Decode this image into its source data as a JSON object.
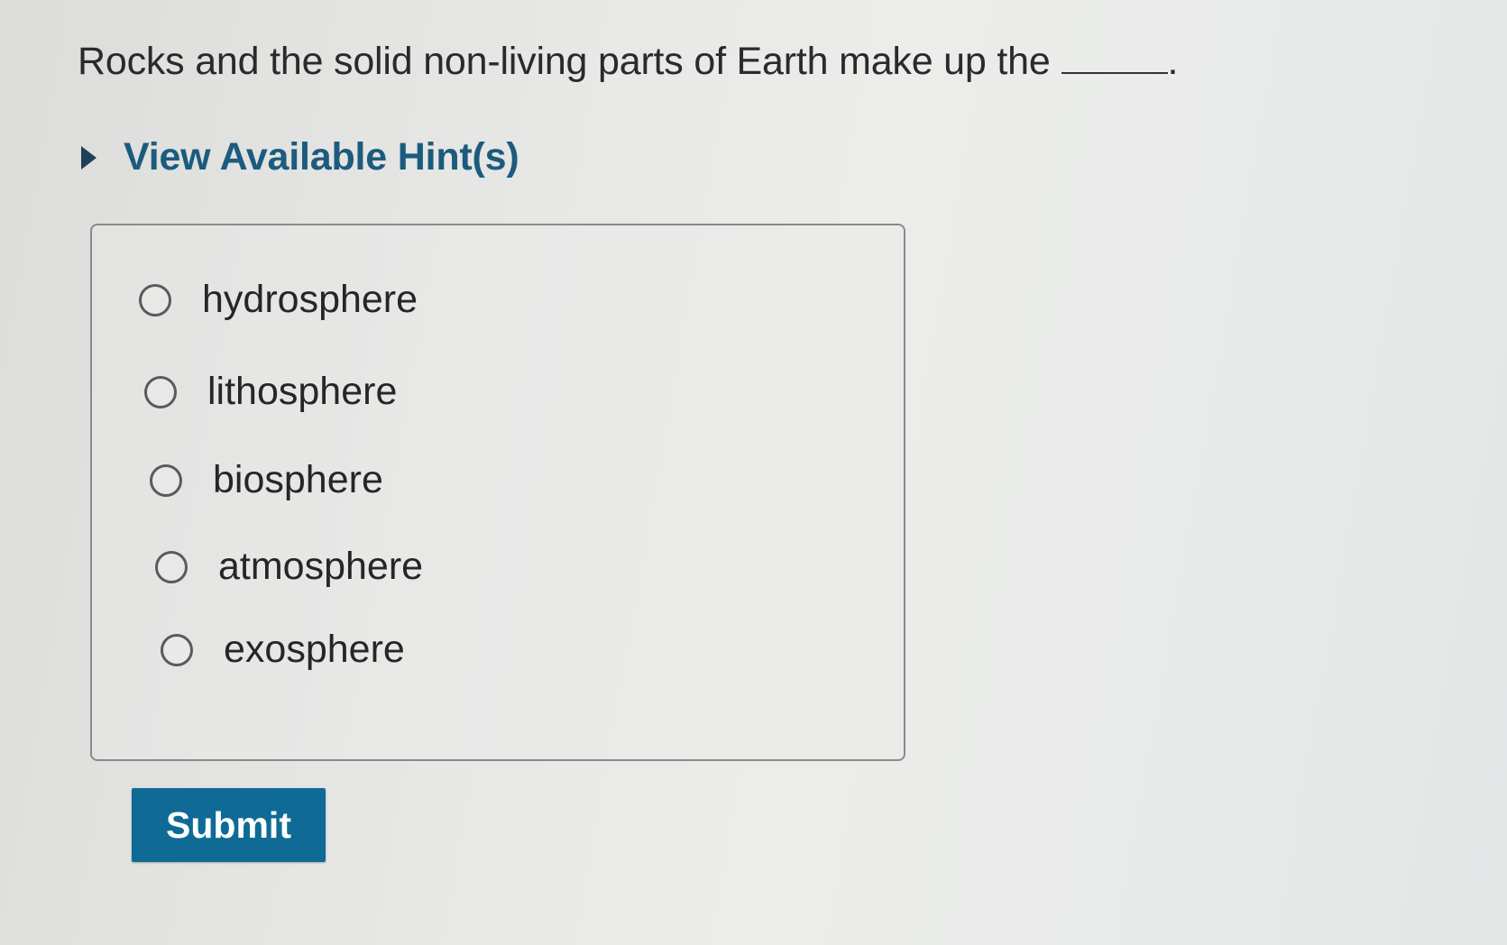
{
  "question": {
    "text": "Rocks and the solid non-living parts of Earth make up the",
    "trailing_punctuation": "."
  },
  "hint": {
    "label": "View Available Hint(s)",
    "arrow_icon": "caret-right-icon",
    "expanded": false
  },
  "options": [
    {
      "label": "hydrosphere",
      "selected": false
    },
    {
      "label": "lithosphere",
      "selected": false
    },
    {
      "label": "biosphere",
      "selected": false
    },
    {
      "label": "atmosphere",
      "selected": false
    },
    {
      "label": "exosphere",
      "selected": false
    }
  ],
  "submit": {
    "label": "Submit"
  },
  "colors": {
    "hint_text": "#1b5c7e",
    "submit_bg": "#0f6b95",
    "question_text": "#2a2a2a"
  }
}
